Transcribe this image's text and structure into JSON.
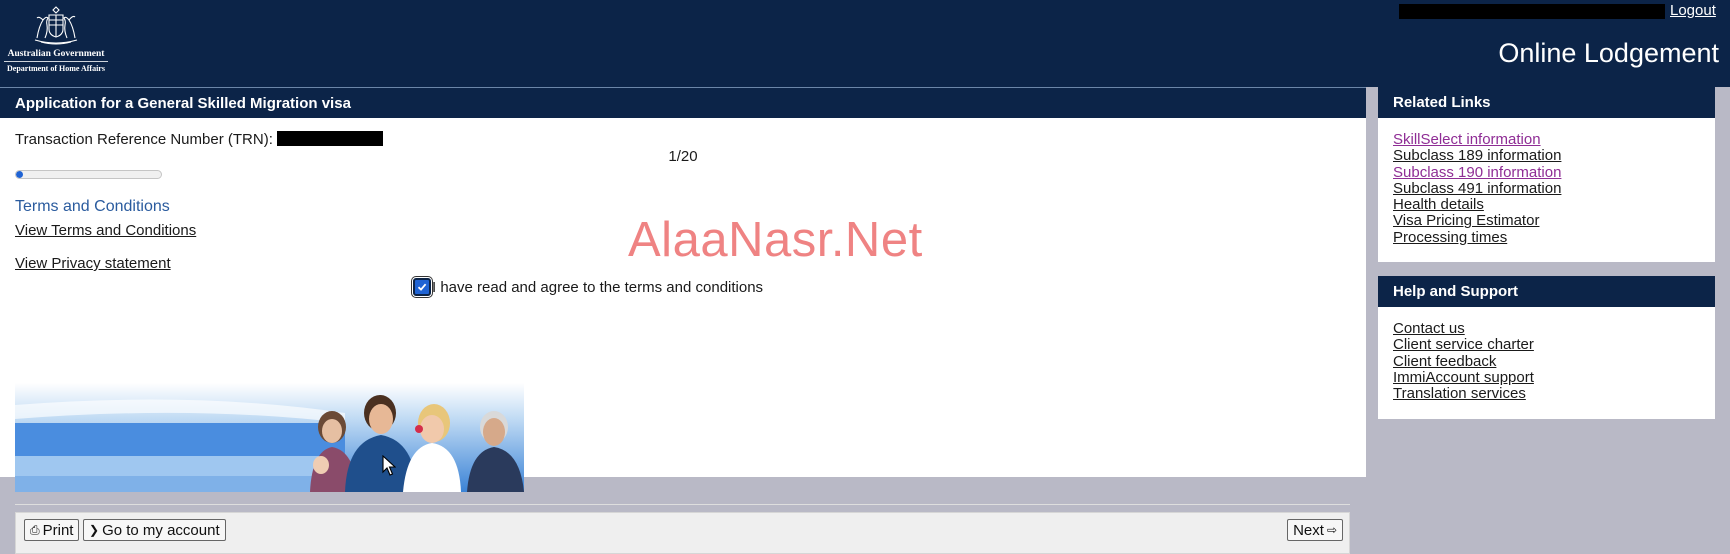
{
  "header": {
    "government": "Australian Government",
    "department": "Department of Home Affairs",
    "logout_label": "Logout",
    "app_title": "Online Lodgement",
    "crest_icon": "commonwealth-coat-of-arms"
  },
  "main": {
    "heading": "Application for a General Skilled Migration visa",
    "trn_label": "Transaction Reference Number (TRN):",
    "progress_text": "1/20",
    "progress_fraction": 0.05,
    "terms_heading": "Terms and Conditions",
    "view_terms_label": "View Terms and Conditions",
    "view_privacy_label": "View Privacy statement",
    "agree_label": "I have read and agree to the terms and conditions",
    "agree_checked": true,
    "watermark": "AlaaNasr.Net"
  },
  "actions": {
    "print_label": "Print",
    "account_label": "Go to my account",
    "next_label": "Next",
    "print_icon": "printer-icon",
    "account_icon": "chevron-right-icon",
    "next_icon": "arrow-right-icon"
  },
  "related_links": {
    "heading": "Related Links",
    "items": [
      {
        "label": "SkillSelect information",
        "visited": true
      },
      {
        "label": "Subclass 189 information",
        "visited": false
      },
      {
        "label": "Subclass 190 information",
        "visited": true
      },
      {
        "label": "Subclass 491 information",
        "visited": false
      },
      {
        "label": "Health details",
        "visited": false
      },
      {
        "label": "Visa Pricing Estimator",
        "visited": false
      },
      {
        "label": "Processing times",
        "visited": false
      }
    ]
  },
  "help_support": {
    "heading": "Help and Support",
    "items": [
      {
        "label": "Contact us"
      },
      {
        "label": "Client service charter"
      },
      {
        "label": "Client feedback"
      },
      {
        "label": "ImmiAccount support"
      },
      {
        "label": "Translation services"
      }
    ]
  },
  "colors": {
    "navy": "#0c2448",
    "visited_link": "#8f2d95",
    "heading_blue": "#2a5b9e",
    "progress_blue": "#1f63d4",
    "watermark": "#ef8383",
    "page_background": "#b9b9c6"
  }
}
